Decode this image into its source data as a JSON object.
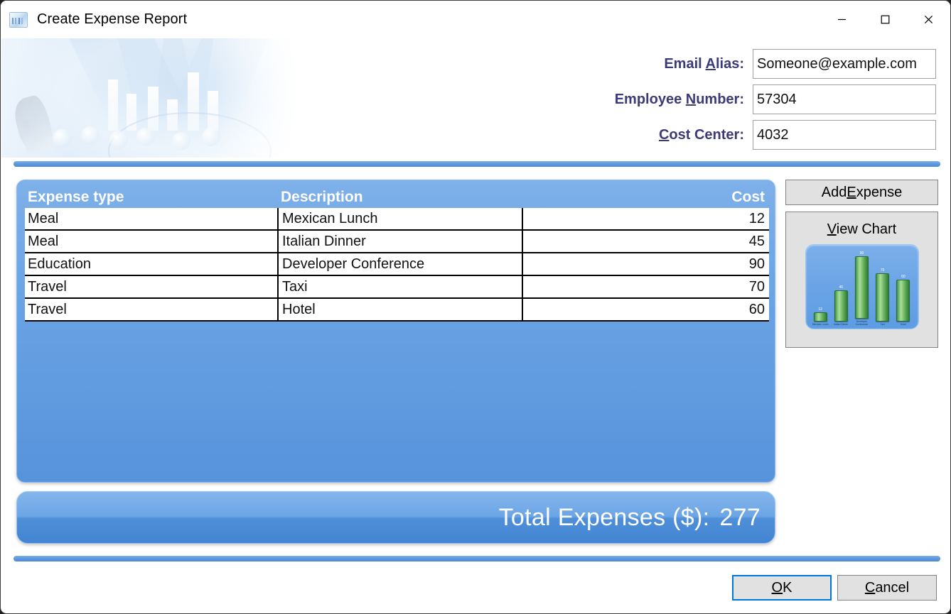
{
  "window": {
    "title": "Create Expense Report",
    "icon": "app-chart-icon",
    "controls": {
      "minimize": "minimize-icon",
      "maximize": "maximize-icon",
      "close": "close-icon"
    }
  },
  "form": {
    "fields": [
      {
        "label_pre": "Email ",
        "label_accel": "A",
        "label_post": "lias:",
        "value": "Someone@example.com",
        "placeholder": ""
      },
      {
        "label_pre": "Employee ",
        "label_accel": "N",
        "label_post": "umber:",
        "value": "57304",
        "placeholder": ""
      },
      {
        "label_pre": "",
        "label_accel": "C",
        "label_post": "ost Center:",
        "value": "4032",
        "placeholder": ""
      }
    ]
  },
  "grid": {
    "columns": [
      "Expense type",
      "Description",
      "Cost"
    ],
    "rows": [
      {
        "type": "Meal",
        "description": "Mexican Lunch",
        "cost": "12"
      },
      {
        "type": "Meal",
        "description": "Italian Dinner",
        "cost": "45"
      },
      {
        "type": "Education",
        "description": "Developer Conference",
        "cost": "90"
      },
      {
        "type": "Travel",
        "description": "Taxi",
        "cost": "70"
      },
      {
        "type": "Travel",
        "description": "Hotel",
        "cost": "60"
      }
    ]
  },
  "total": {
    "label": "Total Expenses ($):",
    "value": "277"
  },
  "buttons": {
    "add_expense": {
      "pre": "Add ",
      "accel": "E",
      "post": "xpense"
    },
    "view_chart": {
      "pre": "",
      "accel": "V",
      "post": "iew Chart"
    },
    "ok": {
      "pre": "",
      "accel": "O",
      "post": "K"
    },
    "cancel": {
      "pre": "",
      "accel": "C",
      "post": "ancel"
    }
  },
  "chart_data": {
    "type": "bar",
    "title": "",
    "xlabel": "",
    "ylabel": "",
    "categories": [
      "Mexican Lunch",
      "Italian Dinner",
      "Developer Conference",
      "Taxi",
      "Hotel"
    ],
    "values": [
      12,
      45,
      90,
      70,
      60
    ],
    "ylim": [
      0,
      100
    ],
    "grid": false,
    "legend": "none",
    "bar_color": "#4f9e4a",
    "background_color": "#6aa4e6",
    "data_labels": true
  },
  "colors": {
    "accent_blue": "#5e9ade",
    "label_purple": "#3b3b78",
    "panel_gray": "#e1e1e1",
    "focus_blue": "#0078d7",
    "bar_green": "#4f9e4a"
  }
}
